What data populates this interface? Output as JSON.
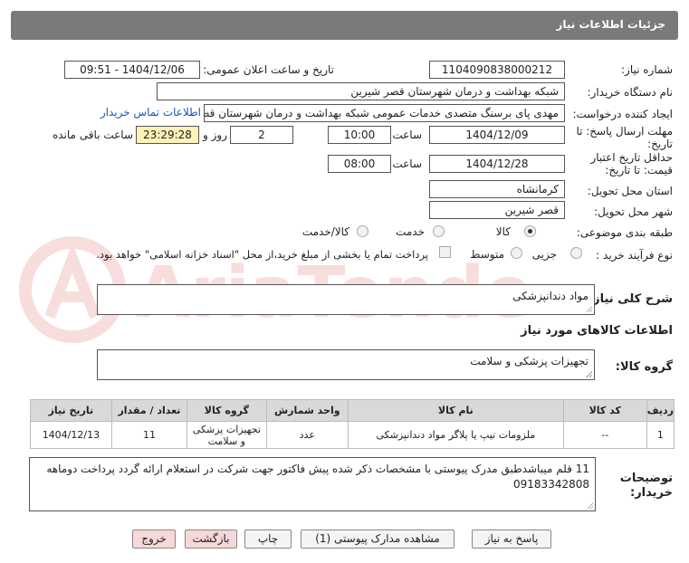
{
  "header": {
    "title": "جزئیات اطلاعات نیاز"
  },
  "need_number": {
    "label": "شماره نیاز:",
    "value": "1104090838000212"
  },
  "announce_datetime": {
    "label": "تاریخ و ساعت اعلان عمومی:",
    "value": "1404/12/06 - 09:51"
  },
  "buyer_org": {
    "label": "نام دستگاه خریدار:",
    "value": "شبکه بهداشت و درمان شهرستان قصر شیرین"
  },
  "requester": {
    "label": "ایجاد کننده درخواست:",
    "value": "مهدی پای برسنگ متصدی خدمات عمومی شبکه بهداشت و درمان شهرستان قصر شیرین",
    "contact_link": "اطلاعات تماس خریدار"
  },
  "deadline": {
    "label_line1": "مهلت ارسال پاسخ: تا",
    "label_line2": "تاریخ:",
    "date": "1404/12/09",
    "time_label": "ساعت",
    "time": "10:00",
    "days": "2",
    "days_label": "روز و",
    "remaining": "23:29:28",
    "remaining_label": "ساعت باقی مانده"
  },
  "price_validity": {
    "label_line1": "حداقل تاریخ اعتبار",
    "label_line2": "قیمت: تا تاریخ:",
    "date": "1404/12/28",
    "time_label": "ساعت",
    "time": "08:00"
  },
  "delivery_province": {
    "label": "استان محل تحویل:",
    "value": "کرمانشاه"
  },
  "delivery_city": {
    "label": "شهر محل تحویل:",
    "value": "قصر شیرین"
  },
  "category": {
    "label": "طبقه بندی موضوعی:",
    "options": [
      "کالا",
      "خدمت",
      "کالا/خدمت"
    ],
    "selected": "کالا"
  },
  "purchase_process": {
    "label": "نوع فرآیند خرید :",
    "options": [
      "جزیی",
      "متوسط"
    ],
    "note": "پرداخت تمام یا بخشی از مبلغ خرید،از محل \"اسناد خزانه اسلامی\" خواهد بود."
  },
  "general_description": {
    "label": "شرح کلی نیاز:",
    "value": "مواد دندانپزشکی"
  },
  "goods_info": {
    "heading": "اطلاعات کالاهای مورد نیاز"
  },
  "goods_group": {
    "label": "گروه کالا:",
    "value": "تجهیزات پزشکی و سلامت"
  },
  "items_table": {
    "headers": [
      "ردیف",
      "کد کالا",
      "نام کالا",
      "واحد شمارش",
      "گروه کالا",
      "تعداد / مقدار",
      "تاریخ نیاز"
    ],
    "rows": [
      [
        "1",
        "--",
        "ملزومات تیپ یا پلاگر مواد دندانپزشکی",
        "عدد",
        "تجهیزات پزشکی و سلامت",
        "11",
        "1404/12/13"
      ]
    ]
  },
  "buyer_notes": {
    "label_line1": "توضیحات",
    "label_line2": "خریدار:",
    "value": "11 قلم میباشدطبق مدرک پیوستی با مشخصات ذکر شده پیش فاکتور جهت شرکت در استعلام  ارائه گردد پرداخت دوماهه 09183342808"
  },
  "buttons": {
    "reply": "پاسخ به نیاز",
    "attachments": "مشاهده مدارک پیوستی (1)",
    "print": "چاپ",
    "back": "بازگشت",
    "exit": "خروج"
  },
  "colors": {
    "header_bg": "#7a7a7a",
    "table_header_bg": "#d9d9d9",
    "remaining_bg": "#fdf3b8",
    "link": "#1a56b8",
    "pink_button": "#f7d7d7"
  }
}
